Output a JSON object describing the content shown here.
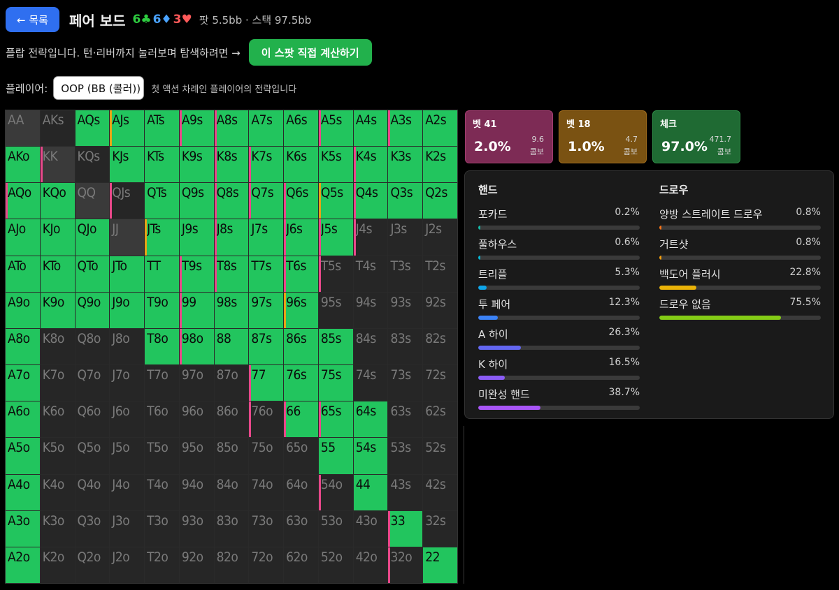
{
  "header": {
    "back_label": "← 목록",
    "title": "페어 보드",
    "board": [
      {
        "rank": "6",
        "suit": "♣",
        "color": "c"
      },
      {
        "rank": "6",
        "suit": "♦",
        "color": "d"
      },
      {
        "rank": "3",
        "suit": "♥",
        "color": "h"
      }
    ],
    "pot": "팟 5.5bb · 스택 97.5bb"
  },
  "intro": {
    "text": "플랍 전략입니다. 턴·리버까지 눌러보며 탐색하려면 →",
    "calc_label": "이 스팟 직접 계산하기"
  },
  "player": {
    "label": "플레이어:",
    "selected": "OOP (BB (콜러))",
    "hint": "첫 액션 차례인 플레이어의 전략입니다"
  },
  "grid": {
    "ranks": [
      "A",
      "K",
      "Q",
      "J",
      "T",
      "9",
      "8",
      "7",
      "6",
      "5",
      "4",
      "3",
      "2"
    ],
    "on": [
      "0011111111111",
      "1001111111111",
      "1100111111111",
      "1110111111000",
      "1111111110000",
      "1111111110000",
      "1000111111000",
      "1000000111000",
      "1000000011100",
      "1000000001100",
      "1000000000100",
      "1000000000010",
      "1000000000001"
    ],
    "marks": [
      "1,1",
      "0,3",
      "0,5",
      "0,6",
      "0,9",
      "0,11",
      "1,6",
      "1,7",
      "1,10",
      "2,0",
      "2,3",
      "2,6",
      "2,7",
      "2,8",
      "2,9",
      "2,10",
      "3,4",
      "3,6",
      "3,8",
      "3,9",
      "3,10",
      "4,5",
      "4,6",
      "4,8",
      "4,9",
      "5,5",
      "5,8",
      "6,5",
      "7,7",
      "8,7",
      "8,8",
      "8,9",
      "10,9",
      "11,11",
      "12,11"
    ],
    "gold_marks": [
      "0,3",
      "2,9",
      "3,4",
      "5,8"
    ]
  },
  "actions": [
    {
      "name": "벳 41",
      "pct": "2.0%",
      "combo": "9.6",
      "combo_label": "콤보"
    },
    {
      "name": "벳 18",
      "pct": "1.0%",
      "combo": "4.7",
      "combo_label": "콤보"
    },
    {
      "name": "체크",
      "pct": "97.0%",
      "combo": "471.7",
      "combo_label": "콤보"
    }
  ],
  "hands": {
    "title": "핸드",
    "items": [
      {
        "label": "포카드",
        "pct": "0.2%",
        "value": 0.2,
        "color": "#14b8a6"
      },
      {
        "label": "풀하우스",
        "pct": "0.6%",
        "value": 0.6,
        "color": "#06b6d4"
      },
      {
        "label": "트리플",
        "pct": "5.3%",
        "value": 5.3,
        "color": "#0ea5e9"
      },
      {
        "label": "투 페어",
        "pct": "12.3%",
        "value": 12.3,
        "color": "#3b82f6"
      },
      {
        "label": "A 하이",
        "pct": "26.3%",
        "value": 26.3,
        "color": "#6366f1"
      },
      {
        "label": "K 하이",
        "pct": "16.5%",
        "value": 16.5,
        "color": "#8b5cf6"
      },
      {
        "label": "미완성 핸드",
        "pct": "38.7%",
        "value": 38.7,
        "color": "#a855f7"
      }
    ]
  },
  "draws": {
    "title": "드로우",
    "items": [
      {
        "label": "양방 스트레이트 드로우",
        "pct": "0.8%",
        "value": 0.8,
        "color": "#f97316"
      },
      {
        "label": "거트샷",
        "pct": "0.8%",
        "value": 0.8,
        "color": "#f59e0b"
      },
      {
        "label": "백도어 플러시",
        "pct": "22.8%",
        "value": 22.8,
        "color": "#eab308"
      },
      {
        "label": "드로우 없음",
        "pct": "75.5%",
        "value": 75.5,
        "color": "#84cc16"
      }
    ]
  }
}
